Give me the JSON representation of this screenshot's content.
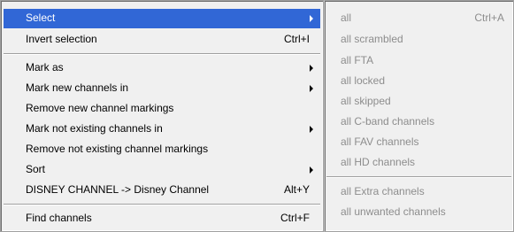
{
  "main_menu": {
    "items": [
      {
        "label": "Select",
        "shortcut": "",
        "has_submenu": true
      },
      {
        "label": "Invert selection",
        "shortcut": "Ctrl+I",
        "has_submenu": false
      },
      {
        "label": "Mark as",
        "shortcut": "",
        "has_submenu": true
      },
      {
        "label": "Mark new channels in",
        "shortcut": "",
        "has_submenu": true
      },
      {
        "label": "Remove new channel markings",
        "shortcut": "",
        "has_submenu": false
      },
      {
        "label": "Mark not existing channels in",
        "shortcut": "",
        "has_submenu": true
      },
      {
        "label": "Remove not existing channel markings",
        "shortcut": "",
        "has_submenu": false
      },
      {
        "label": "Sort",
        "shortcut": "",
        "has_submenu": true
      },
      {
        "label": "DISNEY CHANNEL -> Disney Channel",
        "shortcut": "Alt+Y",
        "has_submenu": false
      },
      {
        "label": "Find channels",
        "shortcut": "Ctrl+F",
        "has_submenu": false
      }
    ]
  },
  "submenu": {
    "items": [
      {
        "label": "all",
        "shortcut": "Ctrl+A"
      },
      {
        "label": "all scrambled",
        "shortcut": ""
      },
      {
        "label": "all FTA",
        "shortcut": ""
      },
      {
        "label": "all locked",
        "shortcut": ""
      },
      {
        "label": "all skipped",
        "shortcut": ""
      },
      {
        "label": "all C-band channels",
        "shortcut": ""
      },
      {
        "label": "all FAV channels",
        "shortcut": ""
      },
      {
        "label": "all HD channels",
        "shortcut": ""
      },
      {
        "label": "all Extra channels",
        "shortcut": ""
      },
      {
        "label": "all unwanted channels",
        "shortcut": ""
      }
    ]
  },
  "colors": {
    "highlight": "#3167d6",
    "menu_background": "#f0f0f0",
    "disabled_text": "#8d8d8d"
  },
  "icons": {
    "submenu_arrow": "triangle-right"
  }
}
